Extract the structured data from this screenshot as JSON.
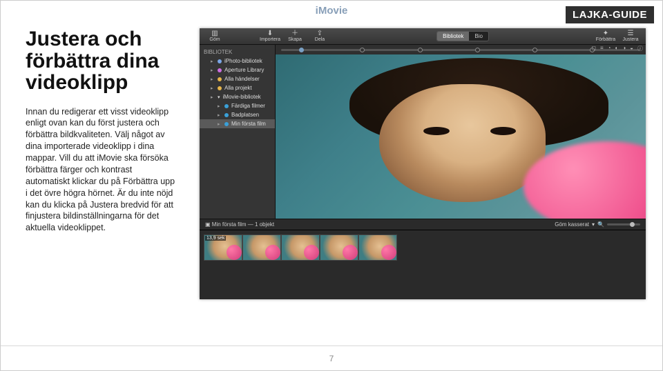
{
  "badge": "LAJKA-GUIDE",
  "app_title": "iMovie",
  "article": {
    "heading": "Justera och förbättra dina videoklipp",
    "body": "Innan du redigerar ett visst videoklipp enligt ovan kan du först justera och förbättra bildkvaliteten. Välj något av dina importerade videoklipp i dina mappar. Vill du att iMovie ska försöka förbättra färger och kontrast automatiskt klickar du på Förbättra upp i det övre högra hörnet. Är du inte nöjd kan du klicka på Justera bredvid för att finjustera bildinställningarna för det aktuella videoklippet."
  },
  "imovie": {
    "toolbar": {
      "hide": "Göm",
      "import": "Importera",
      "create": "Skapa",
      "share": "Dela",
      "seg_library": "Bibliotek",
      "seg_theater": "Bio",
      "enhance": "Förbättra",
      "adjust": "Justera"
    },
    "sidebar": {
      "header": "BIBLIOTEK",
      "items": [
        {
          "label": "iPhoto-bibliotek",
          "icon": "star",
          "color": "#7aa6e6"
        },
        {
          "label": "Aperture Library",
          "icon": "star",
          "color": "#cf6ee2"
        },
        {
          "label": "Alla händelser",
          "icon": "star",
          "color": "#e6b54a"
        },
        {
          "label": "Alla projekt",
          "icon": "star",
          "color": "#e6b54a"
        }
      ],
      "lib_header": "iMovie-bibliotek",
      "sub_items": [
        {
          "label": "Färdiga filmer",
          "icon": "cal",
          "color": "#3aa0d8"
        },
        {
          "label": "Badplatsen",
          "icon": "cal",
          "color": "#3aa0d8"
        },
        {
          "label": "Min första film",
          "icon": "cal",
          "active": true,
          "color": "#3aa0d8"
        }
      ]
    },
    "preview": {
      "controls": [
        "◻",
        "≡",
        "◔",
        "◐",
        "◑",
        "◒",
        "ⓘ"
      ]
    },
    "strip": {
      "title_left_prefix": "Min första film — ",
      "title_left_count": "1 objekt",
      "title_right": "Göm kasserat",
      "thumb_tag": "13,9 sek"
    }
  },
  "page_number": "7",
  "logo": "LAJKA"
}
